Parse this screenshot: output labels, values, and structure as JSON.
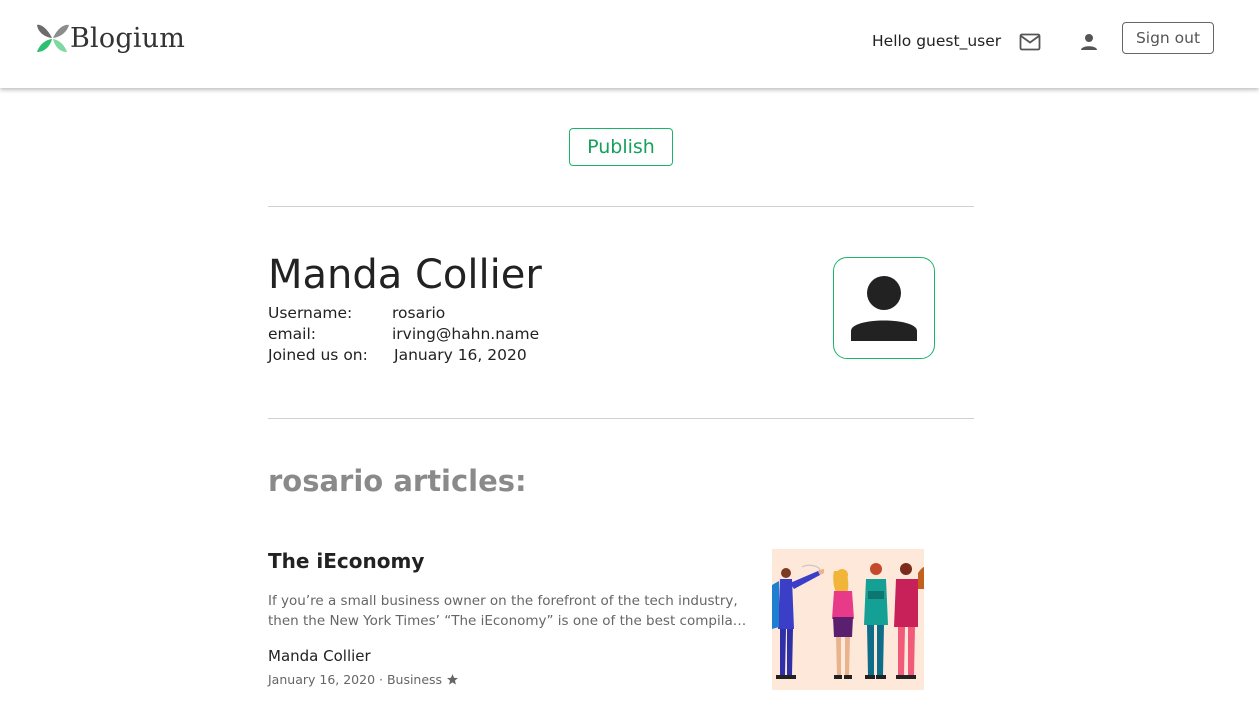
{
  "header": {
    "brand": "Blogium",
    "greeting": "Hello guest_user",
    "mail_icon": "mail-icon",
    "user_icon": "person-icon",
    "signout_label": "Sign out"
  },
  "actions": {
    "publish_label": "Publish"
  },
  "profile": {
    "name": "Manda Collier",
    "fields": [
      {
        "label": "Username:",
        "value": "rosario"
      },
      {
        "label": "email:",
        "value": "irving@hahn.name"
      },
      {
        "label": "Joined us on:",
        "value": "January 16, 2020"
      }
    ],
    "avatar_icon": "person-icon"
  },
  "articles": {
    "heading": "rosario articles:",
    "items": [
      {
        "title": "The iEconomy",
        "excerpt_line1": "If you’re a small business owner on the forefront of the tech industry,",
        "excerpt_line2": "then the New York Times’ “The iEconomy” is one of the best compilatio...",
        "author": "Manda Collier",
        "meta": "January 16, 2020 · Business",
        "star_icon": "star-icon"
      }
    ]
  },
  "colors": {
    "accent": "#1bb56a",
    "text": "#222222",
    "muted": "#8a8a8a"
  }
}
